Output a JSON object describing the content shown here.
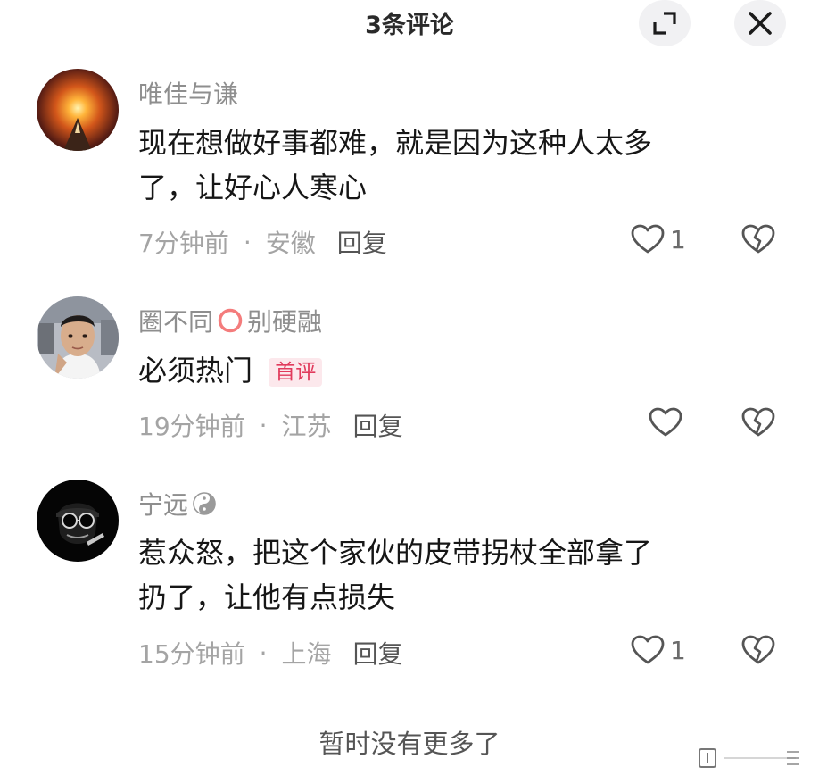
{
  "header": {
    "title": "3条评论",
    "expand_icon": "expand-icon",
    "close_icon": "close-icon"
  },
  "comments": [
    {
      "username": "唯佳与谦",
      "text_line1": "现在想做好事都难，就是因为这种人太多",
      "text_line2": "了，让好心人寒心",
      "time": "7分钟前",
      "location": "安徽",
      "reply_label": "回复",
      "like_count": "1"
    },
    {
      "username_part1": "圈不同",
      "username_part2": "别硬融",
      "text": "必须热门",
      "badge": "首评",
      "time": "19分钟前",
      "location": "江苏",
      "reply_label": "回复",
      "like_count": ""
    },
    {
      "username": "宁远",
      "text_line1": "惹众怒，把这个家伙的皮带拐杖全部拿了",
      "text_line2": "扔了，让他有点损失",
      "time": "15分钟前",
      "location": "上海",
      "reply_label": "回复",
      "like_count": "1"
    }
  ],
  "footer": {
    "end_text": "暂时没有更多了"
  },
  "colors": {
    "badge_bg": "#fce8ec",
    "badge_text": "#e13a5c",
    "meta": "#a4a4a4",
    "username": "#8e8e8e"
  }
}
